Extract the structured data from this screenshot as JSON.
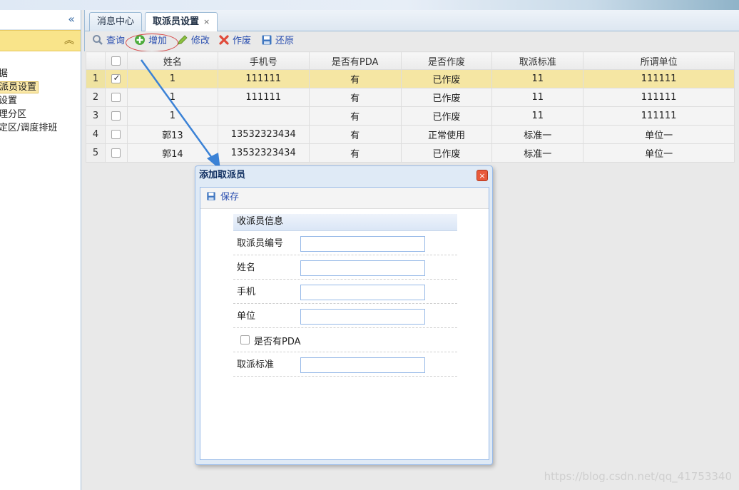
{
  "sidebar": {
    "collapse_icon": "double-chevron-left-icon",
    "panel_caret_icon": "double-chevron-up-icon",
    "items": [
      {
        "label": "据"
      },
      {
        "label": "派员设置"
      },
      {
        "label": "设置"
      },
      {
        "label": "理分区"
      },
      {
        "label": "定区/调度排班"
      }
    ]
  },
  "tabs": [
    {
      "label": "消息中心"
    },
    {
      "label": "取派员设置",
      "close": "×"
    }
  ],
  "toolbar": {
    "search": "查询",
    "add": "增加",
    "edit": "修改",
    "void": "作废",
    "restore": "还原"
  },
  "grid": {
    "columns": [
      "姓名",
      "手机号",
      "是否有PDA",
      "是否作废",
      "取派标准",
      "所谓单位"
    ],
    "rows": [
      {
        "n": "1",
        "checked": true,
        "name": "1",
        "phone": "111111",
        "pda": "有",
        "void": "已作废",
        "std": "11",
        "unit": "111111"
      },
      {
        "n": "2",
        "checked": false,
        "name": "1",
        "phone": "111111",
        "pda": "有",
        "void": "已作废",
        "std": "11",
        "unit": "111111"
      },
      {
        "n": "3",
        "checked": false,
        "name": "1",
        "phone": "",
        "pda": "有",
        "void": "已作废",
        "std": "11",
        "unit": "111111"
      },
      {
        "n": "4",
        "checked": false,
        "name": "郭13",
        "phone": "13532323434",
        "pda": "有",
        "void": "正常使用",
        "std": "标准一",
        "unit": "单位一"
      },
      {
        "n": "5",
        "checked": false,
        "name": "郭14",
        "phone": "13532323434",
        "pda": "有",
        "void": "已作废",
        "std": "标准一",
        "unit": "单位一"
      }
    ]
  },
  "dialog": {
    "title": "添加取派员",
    "close": "×",
    "save": "保存",
    "section": "收派员信息",
    "fields": {
      "id": "取派员编号",
      "name": "姓名",
      "phone": "手机",
      "unit": "单位",
      "pda": "是否有PDA",
      "std": "取派标准"
    }
  },
  "watermark": "https://blog.csdn.net/qq_41753340",
  "colors": {
    "accent": "#2b4fb0",
    "selected_row": "#f5e6a3",
    "highlight_circle": "#d64545",
    "arrow": "#3b82d6"
  }
}
